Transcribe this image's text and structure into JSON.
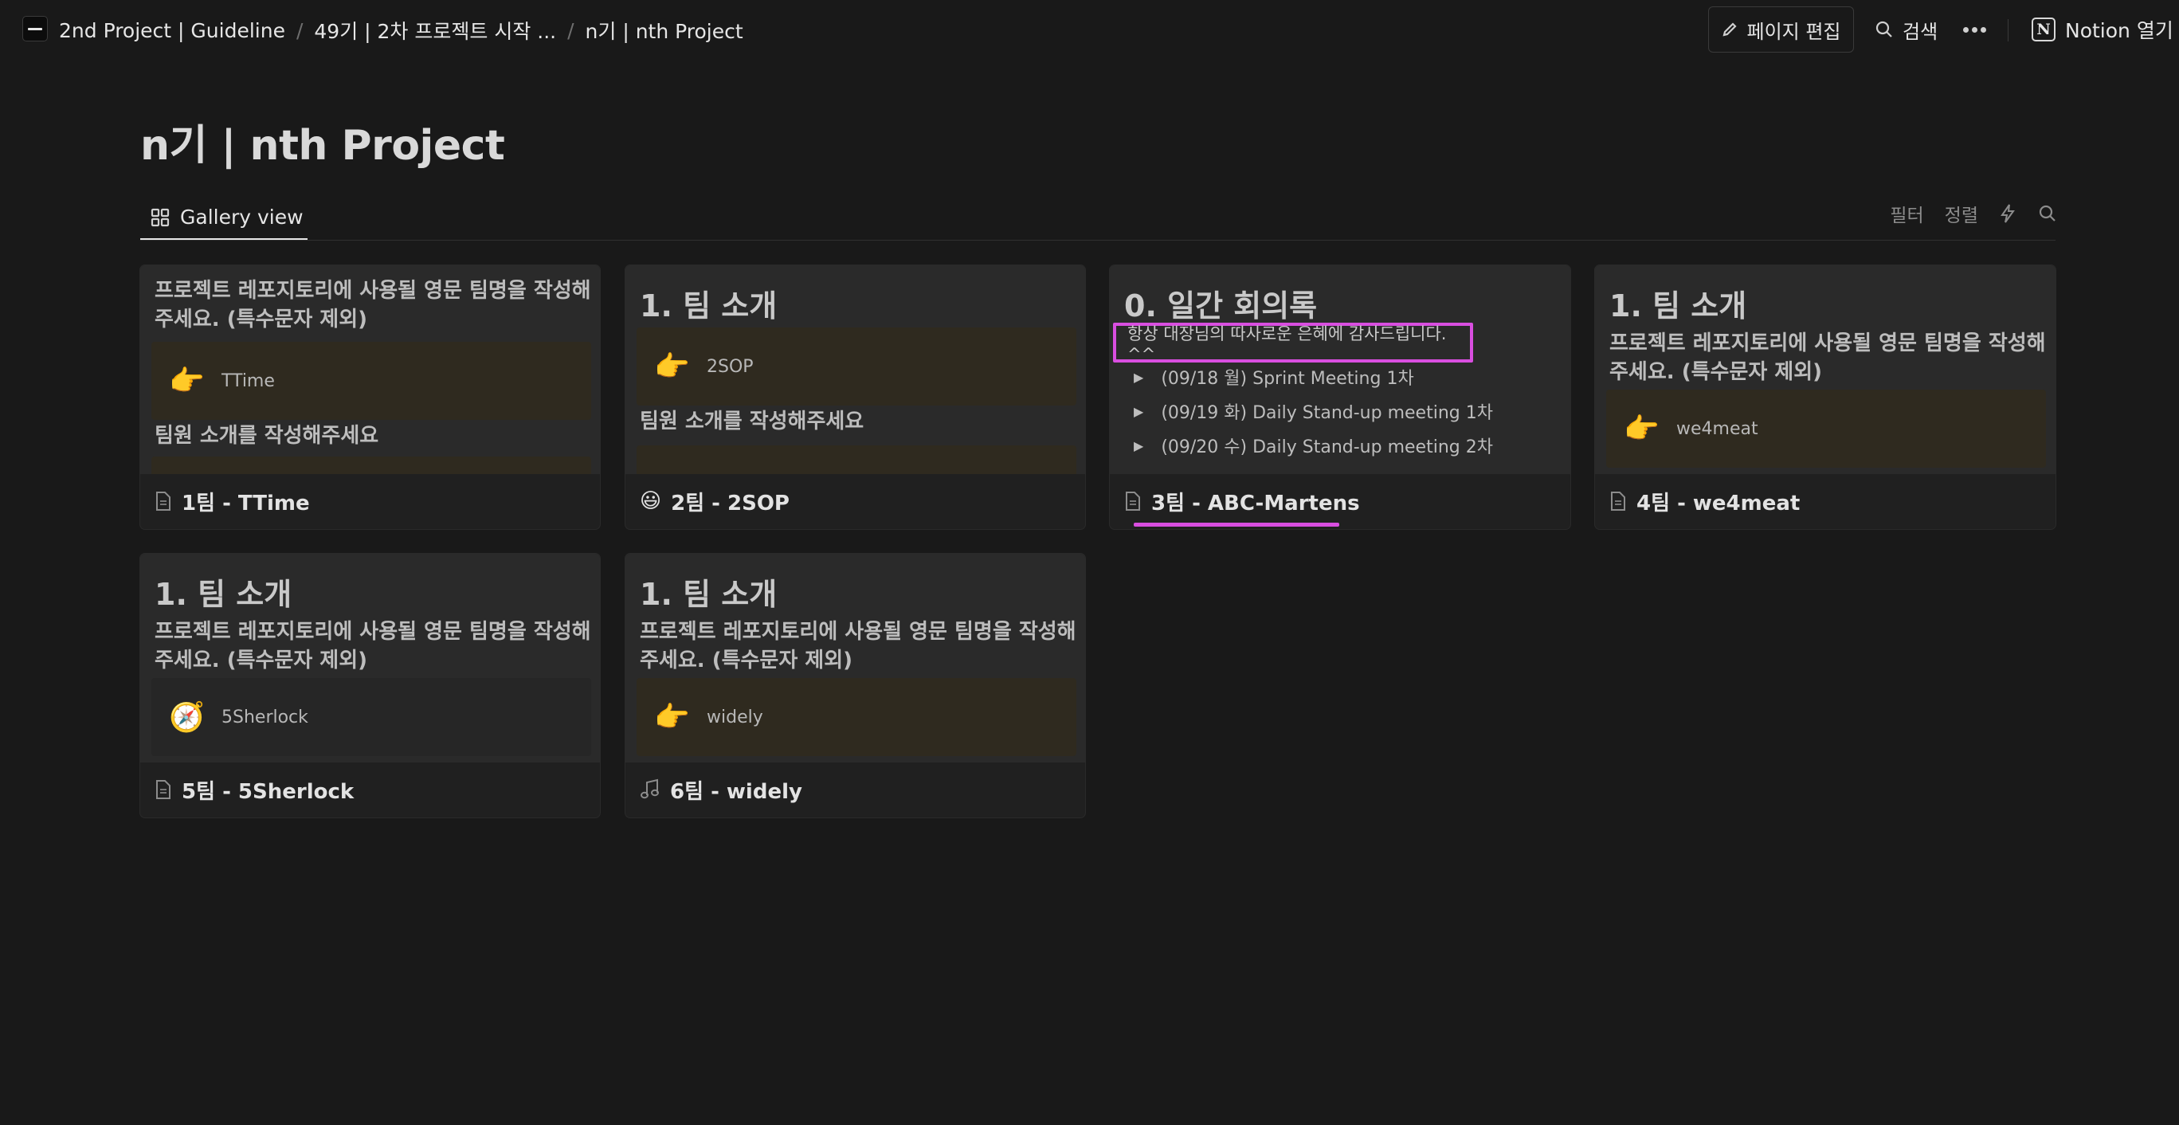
{
  "breadcrumb": {
    "items": [
      "2nd Project | Guideline",
      "49기 | 2차 프로젝트 시작 ...",
      "n기 | nth Project"
    ],
    "separator": "/"
  },
  "header": {
    "edit_label": "페이지 편집",
    "search_label": "검색",
    "open_notion_label": "Notion 열기"
  },
  "page": {
    "title": "n기 | nth Project"
  },
  "view": {
    "tab_label": "Gallery view",
    "filter_label": "필터",
    "sort_label": "정렬"
  },
  "cards": [
    {
      "title": "1팀 - TTime",
      "icon": "page-icon",
      "preview": {
        "para": "프로젝트 레포지토리에 사용될 영문 팀명을 작성해주세요. (특수문자 제외)",
        "callout_emoji": "👉",
        "callout_text": "TTime",
        "para2": "팀원 소개를 작성해주세요"
      }
    },
    {
      "title": "2팀 - 2SOP",
      "icon": "😃",
      "preview": {
        "heading": "1. 팀 소개",
        "callout_emoji": "👉",
        "callout_text": "2SOP",
        "para2": "팀원 소개를 작성해주세요"
      }
    },
    {
      "title": "3팀 - ABC-Martens",
      "icon": "page-icon",
      "preview": {
        "heading": "0. 일간 회의록",
        "highlight_text": "항상 대장님의 따사로운 은혜에 감사드립니다. ^^",
        "toggles": [
          "(09/18 월) Sprint Meeting 1차",
          "(09/19 화) Daily Stand-up meeting 1차",
          "(09/20 수) Daily Stand-up meeting 2차"
        ]
      }
    },
    {
      "title": "4팀 - we4meat",
      "icon": "page-icon",
      "preview": {
        "heading": "1. 팀 소개",
        "para": "프로젝트 레포지토리에 사용될 영문 팀명을 작성해주세요. (특수문자 제외)",
        "callout_emoji": "👉",
        "callout_text": "we4meat"
      }
    },
    {
      "title": "5팀 - 5Sherlock",
      "icon": "page-icon",
      "preview": {
        "heading": "1. 팀 소개",
        "para": "프로젝트 레포지토리에 사용될 영문 팀명을 작성해주세요. (특수문자 제외)",
        "callout_emoji": "🧭",
        "callout_text": "5Sherlock"
      }
    },
    {
      "title": "6팀 - widely",
      "icon": "music-note-icon",
      "preview": {
        "heading": "1. 팀 소개",
        "para": "프로젝트 레포지토리에 사용될 영문 팀명을 작성해주세요. (특수문자 제외)",
        "callout_emoji": "👉",
        "callout_text": "widely"
      }
    }
  ],
  "colors": {
    "background": "#191919",
    "card": "#202020",
    "preview": "#2a2a2a",
    "callout": "#2f2a1f",
    "annotation": "#d94ee0"
  }
}
